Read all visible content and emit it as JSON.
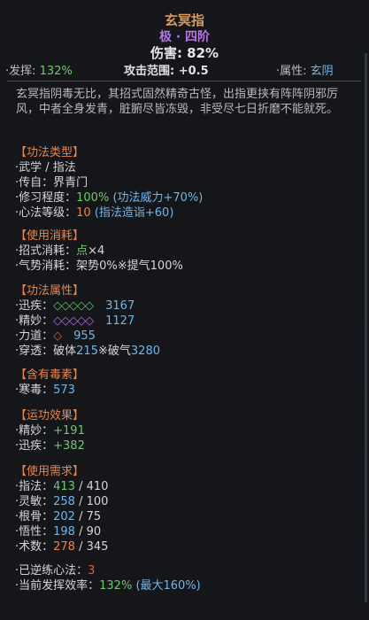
{
  "title": "玄冥指",
  "tier": "极 · 四阶",
  "damage": "伤害: 82%",
  "stats": {
    "fahui_label": "·发挥: ",
    "fahui_value": "132%",
    "range_label": "攻击范围: ",
    "range_value": "+0.5",
    "attr_label": "·属性: ",
    "attr_value": "玄阴"
  },
  "description": "玄冥指阴毒无比，其招式固然精奇古怪，出指更挟有阵阵阴邪厉风，中者全身发青，脏腑尽皆冻毁，非受尽七日折磨不能就死。",
  "sections": {
    "type": {
      "header": "【功法类型】",
      "l1": "·武学 / 指法",
      "l2": "·传自：界青门",
      "l3_label": "·修习程度：",
      "l3_value": "100%",
      "l3_extra": " (功法威力+70%)",
      "l4_label": "·心法等级：",
      "l4_value": "10",
      "l4_extra": " (指法造诣+60)"
    },
    "cost": {
      "header": "【使用消耗】",
      "l1_label": "·招式消耗：",
      "l1_value": "点",
      "l1_extra": "×4",
      "l2_label": "·气势消耗：",
      "l2_value": "架势0%※提气100%"
    },
    "props": {
      "header": "【功法属性】",
      "speed_label": "·迅疾：",
      "speed_dia": "◇◇◇◇◇",
      "speed_value": "3167",
      "subtle_label": "·精妙：",
      "subtle_dia": "◇◇◇◇◇",
      "subtle_value": "1127",
      "power_label": "·力道：",
      "power_dia": "◇",
      "power_value": "955",
      "pierce_label": "·穿透：",
      "pierce_a": "破体",
      "pierce_av": "215",
      "pierce_sep": "※",
      "pierce_b": "破气",
      "pierce_bv": "3280"
    },
    "poison": {
      "header": "【含有毒素】",
      "l1_label": "·寒毒：",
      "l1_value": "573"
    },
    "effect": {
      "header": "【运功效果】",
      "l1_label": "·精妙：",
      "l1_value": "+191",
      "l2_label": "·迅疾：",
      "l2_value": "+382"
    },
    "req": {
      "header": "【使用需求】",
      "rows": [
        {
          "label": "·指法：",
          "cur": "413",
          "max": " / 410"
        },
        {
          "label": "·灵敏：",
          "cur": "258",
          "max": " / 100"
        },
        {
          "label": "·根骨：",
          "cur": "202",
          "max": " / 75"
        },
        {
          "label": "·悟性：",
          "cur": "198",
          "max": " / 90"
        },
        {
          "label": "·术数：",
          "cur": "278",
          "max": " / 345"
        }
      ]
    },
    "footer": {
      "l1_label": "·已逆练心法：",
      "l1_value": "3",
      "l2_label": "·当前发挥效率：",
      "l2_value": "132%",
      "l2_extra": " (最大160%)"
    }
  }
}
